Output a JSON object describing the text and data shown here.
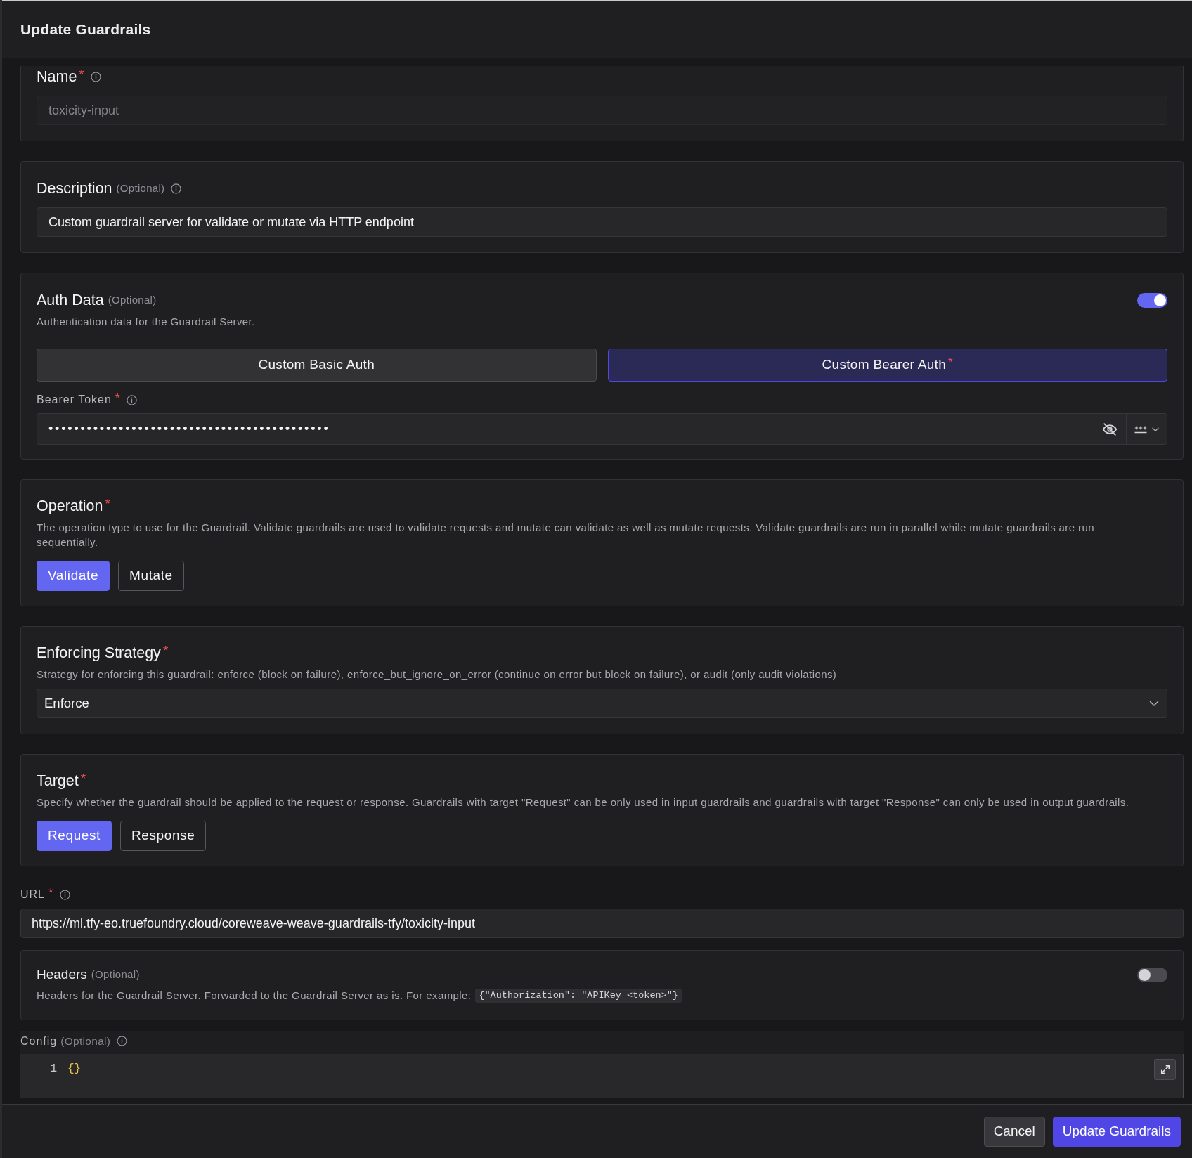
{
  "dialog": {
    "title": "Update Guardrails"
  },
  "sections": [
    {
      "kind": "input",
      "label": "Name",
      "required_mark": "*",
      "info": true,
      "value": "toxicity-input",
      "disabled": true
    },
    {
      "kind": "input",
      "label": "Description",
      "optional": "(Optional)",
      "info": true,
      "value": "Custom guardrail server for validate or mutate via HTTP endpoint",
      "disabled": false
    },
    {
      "kind": "auth",
      "label": "Auth Data",
      "optional": "(Optional)",
      "on": true,
      "description": "Authentication data for the Guardrail Server.",
      "options": [
        {
          "label": "Custom Basic Auth",
          "selected": false
        },
        {
          "label": "Custom Bearer Auth",
          "required_mark": "*",
          "selected": true
        }
      ],
      "token": {
        "label": "Bearer Token",
        "required_mark": "*",
        "info": true,
        "value": "••••••••••••••••••••••••••••••••••••••••••••",
        "masked": true
      }
    },
    {
      "kind": "choice",
      "label": "Operation",
      "required_mark": "*",
      "description": "The operation type to use for the Guardrail. Validate guardrails are used to validate requests and mutate can validate as well as mutate requests. Validate guardrails are run in parallel while mutate guardrails are run sequentially.",
      "options": [
        {
          "label": "Validate",
          "selected": true
        },
        {
          "label": "Mutate",
          "selected": false
        }
      ]
    },
    {
      "kind": "select",
      "label": "Enforcing Strategy",
      "required_mark": "*",
      "description": "Strategy for enforcing this guardrail: enforce (block on failure), enforce_but_ignore_on_error (continue on error but block on failure), or audit (only audit violations)",
      "value": "Enforce"
    },
    {
      "kind": "choice",
      "label": "Target",
      "required_mark": "*",
      "description": "Specify whether the guardrail should be applied to the request or response. Guardrails with target \"Request\" can be only used in input guardrails and guardrails with target \"Response\" can only be used in output guardrails.",
      "options": [
        {
          "label": "Request",
          "selected": true
        },
        {
          "label": "Response",
          "selected": false
        }
      ]
    },
    {
      "kind": "plain_input",
      "label": "URL",
      "required_mark": "*",
      "info": true,
      "value": "https://ml.tfy-eo.truefoundry.cloud/coreweave-weave-guardrails-tfy/toxicity-input"
    },
    {
      "kind": "toggle",
      "label": "Headers",
      "optional": "(Optional)",
      "on": false,
      "description": "Headers for the Guardrail Server. Forwarded to the Guardrail Server as is. For example:",
      "code": "{\"Authorization\": \"APIKey <token>\"}"
    },
    {
      "kind": "code_editor",
      "label": "Config",
      "optional": "(Optional)",
      "info": true,
      "lines": [
        {
          "number": "1",
          "text": "{}"
        }
      ]
    }
  ],
  "footer": {
    "buttons": [
      {
        "label": "Cancel",
        "kind": "secondary"
      },
      {
        "label": "Update Guardrails",
        "kind": "primary"
      }
    ]
  }
}
